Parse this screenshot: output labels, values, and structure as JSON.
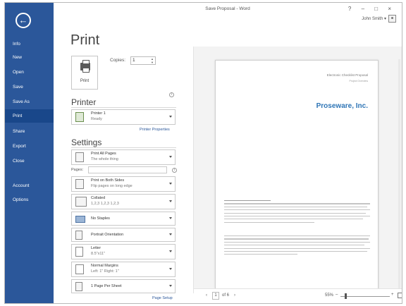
{
  "window": {
    "title": "Save Proposal - Word",
    "controls": "? – □ ×",
    "user_name": "John Smith ▾"
  },
  "sidebar": {
    "back_icon": "back-arrow-icon",
    "items": [
      {
        "label": "Info",
        "active": false
      },
      {
        "label": "New",
        "active": false
      },
      {
        "label": "Open",
        "active": false
      },
      {
        "label": "Save",
        "active": false
      },
      {
        "label": "Save As",
        "active": false
      },
      {
        "label": "Print",
        "active": true
      },
      {
        "label": "Share",
        "active": false
      },
      {
        "label": "Export",
        "active": false
      },
      {
        "label": "Close",
        "active": false
      },
      {
        "label": "Account",
        "active": false
      },
      {
        "label": "Options",
        "active": false
      }
    ]
  },
  "print": {
    "heading": "Print",
    "button_label": "Print",
    "copies_label": "Copies:",
    "copies_value": "1",
    "printer_title": "Printer",
    "printer_name": "Printer 1",
    "printer_status": "Ready",
    "printer_properties_link": "Printer Properties",
    "settings_title": "Settings",
    "print_pages": {
      "line1": "Print All Pages",
      "line2": "The whole thing"
    },
    "pages_label": "Pages:",
    "sides": {
      "line1": "Print on Both Sides",
      "line2": "Flip pages on long edge"
    },
    "collated": {
      "line1": "Collated",
      "line2": "1,2,3    1,2,3    1,2,3"
    },
    "staples": {
      "line1": "No Staples"
    },
    "orientation": {
      "line1": "Portrait Orientation"
    },
    "paper": {
      "line1": "Letter",
      "line2": "8.5\"x11\""
    },
    "margins": {
      "line1": "Normal Margins",
      "line2": "Left: 1\"    Right: 1\""
    },
    "per_sheet": {
      "line1": "1 Page Per Sheet"
    },
    "page_setup_link": "Page Setup"
  },
  "preview": {
    "header_line1": "Electronic Checklist Proposal",
    "header_line2": "Project Overview",
    "company": "Proseware, Inc.",
    "page_current": "1",
    "page_of": "of 6",
    "prev_icon": "‹",
    "next_icon": "›",
    "zoom": "55%",
    "zoom_minus": "–",
    "zoom_plus": "+"
  },
  "colors": {
    "accent": "#2b579a",
    "active_nav": "#19478a",
    "company_blue": "#2e75b6"
  }
}
